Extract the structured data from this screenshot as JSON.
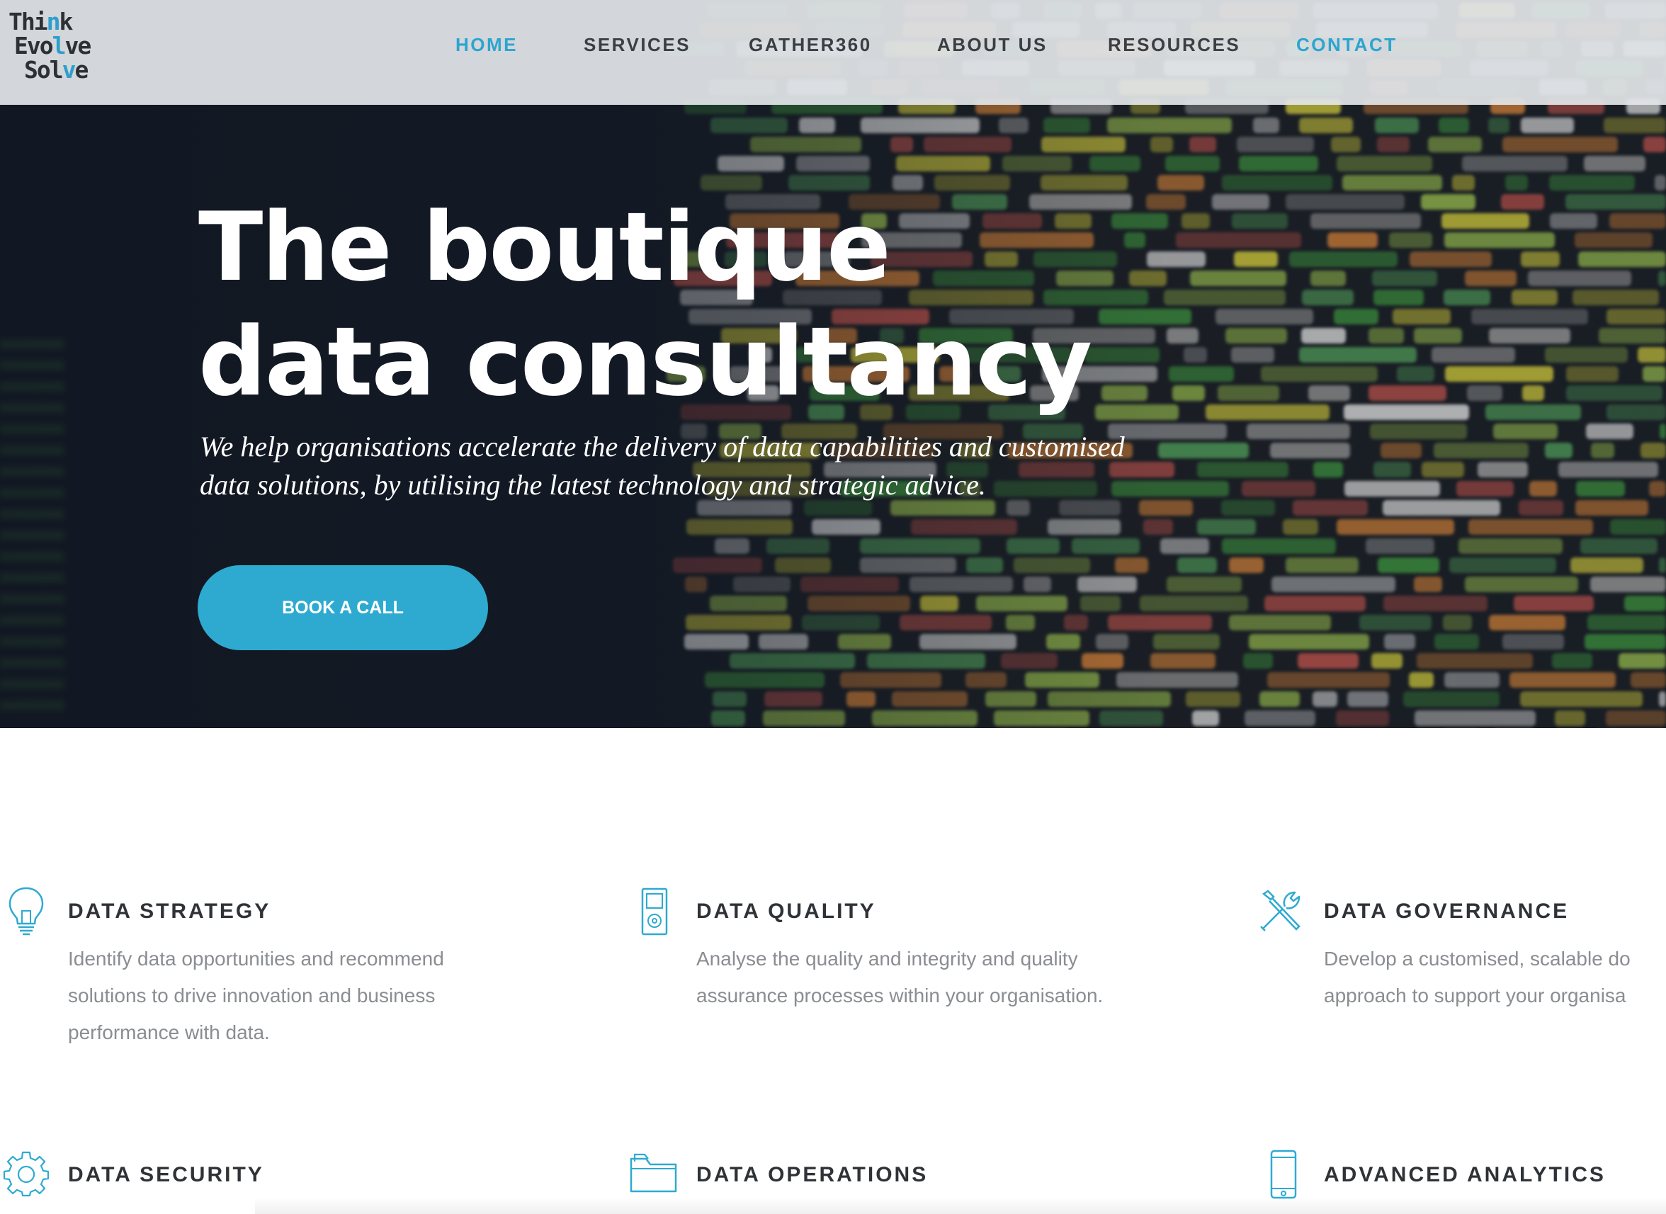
{
  "header": {
    "logo": {
      "lines": [
        "Think",
        "Evolve",
        "Solve"
      ]
    },
    "nav": [
      {
        "label": "HOME"
      },
      {
        "label": "SERVICES"
      },
      {
        "label": "GATHER360"
      },
      {
        "label": "ABOUT US"
      },
      {
        "label": "RESOURCES"
      },
      {
        "label": "CONTACT"
      }
    ],
    "active_item": "HOME",
    "highlighted_item": "CONTACT"
  },
  "hero": {
    "title_line1": "The boutique",
    "title_line2": "data consultancy",
    "subtitle_line1": "We help organisations accelerate the delivery of data capabilities and customised",
    "subtitle_line2": "data solutions, by utilising the latest technology and strategic advice.",
    "cta_label": "BOOK A CALL",
    "background": "blurred-source-code-photo"
  },
  "services": [
    {
      "icon": "lightbulb-icon",
      "title": "DATA STRATEGY",
      "desc": [
        "Identify data opportunities and recommend",
        "solutions to drive innovation and business",
        "performance with data."
      ]
    },
    {
      "icon": "ipod-icon",
      "title": "DATA QUALITY",
      "desc": [
        "Analyse the quality and integrity and quality",
        "assurance processes within your organisation."
      ]
    },
    {
      "icon": "tools-icon",
      "title": "DATA GOVERNANCE",
      "desc": [
        "Develop a customised, scalable do",
        "approach to support your organisa"
      ]
    },
    {
      "icon": "gear-icon",
      "title": "DATA SECURITY",
      "desc": []
    },
    {
      "icon": "folder-icon",
      "title": "DATA OPERATIONS",
      "desc": []
    },
    {
      "icon": "phone-icon",
      "title": "ADVANCED ANALYTICS",
      "desc": []
    }
  ],
  "colors": {
    "accent": "#2eaad1",
    "nav_text": "#3b3f44",
    "heading_text": "#2f3338",
    "body_text": "#8a8d91",
    "hero_bg": "#141b26"
  }
}
